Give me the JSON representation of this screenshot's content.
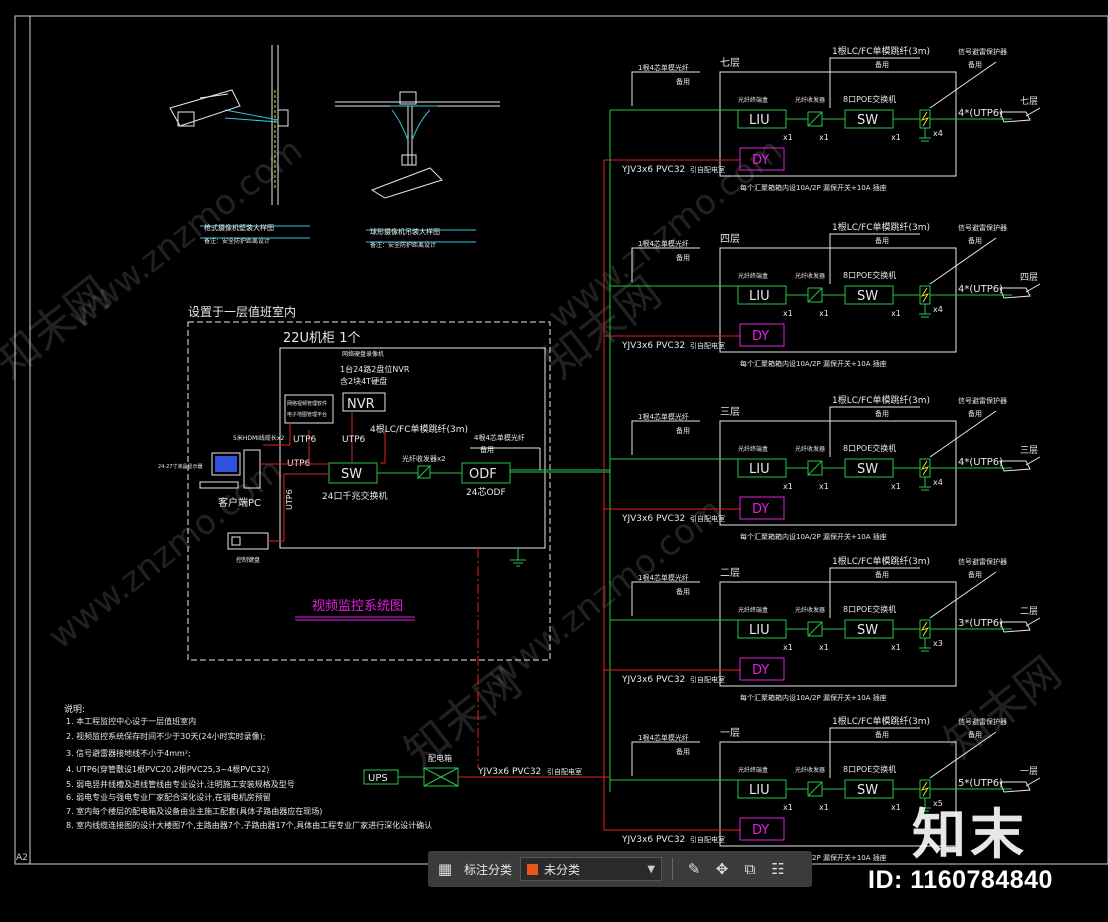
{
  "sheet": {
    "frame_label": "A2",
    "cabinet_room": "设置于一层值班室内",
    "cabinet": "22U机柜 1个",
    "nvr_header": "网络硬盘录像机",
    "nvr_desc1": "1台24路2盘位NVR",
    "nvr_desc2": "含2块4T硬盘",
    "nvr": "NVR",
    "mgmt_box1": "网络视频管理软件",
    "mgmt_box2": "电子地图管理平台",
    "hdmi": "5米HDMI线缆长x2",
    "utp6_a": "UTP6",
    "utp6_b": "UTP6",
    "utp6_c": "UTP6",
    "utp6_d": "UTP6",
    "sw": "SW",
    "sw_desc": "24口千兆交换机",
    "fiber_jumper": "4根LC/FC单模跳纤(3m)",
    "converter": "光纤收发器x2",
    "odf": "ODF",
    "odf_desc": "24芯ODF",
    "riser_fiber": "4根4芯单模光纤",
    "riser_fiber2": "备用",
    "client_pc": "客户端PC",
    "monitor_note": "24-27寸液晶显示器",
    "keyboard": "控制键盘",
    "title": "视频监控系统图",
    "detail1": "枪式摄像机壁装大样图",
    "detail1_note": "备注：安全防护距离设计",
    "detail2": "球形摄像机吊装大样图",
    "detail2_note": "备注：安全防护距离设计",
    "notes_title": "说明:",
    "notes": [
      "1. 本工程监控中心设于一层值班室内",
      "2. 视频监控系统保存时间不少于30天(24小时实时录像);",
      "3. 信号避雷器接地线不小于4mm²;",
      "4. UTP6(穿管敷设1根PVC20,2根PVC25,3~4根PVC32)",
      "5. 弱电竖井线槽及进线管线由专业设计,注明施工安装规格及型号",
      "6. 弱电专业与强电专业厂家配合深化设计,在弱电机房预留",
      "7. 室内每个楼层的配电箱及设备由业主施工配套(具体子路由器应在现场)",
      "8. 室内线缆连接图的设计大楼图7个,主路由器7个,子路由器17个,具体由工程专业厂家进行深化设计确认"
    ],
    "ups": "UPS",
    "pdu": "配电箱",
    "main_power": "YJV3x6 PVC32",
    "main_power_note": "引自配电室",
    "floors": [
      {
        "name": "七层",
        "tag": "七层",
        "cams": "4*(UTP6)",
        "x": "x4"
      },
      {
        "name": "四层",
        "tag": "四层",
        "cams": "4*(UTP6)",
        "x": "x4"
      },
      {
        "name": "三层",
        "tag": "三层",
        "cams": "4*(UTP6)",
        "x": "x4"
      },
      {
        "name": "二层",
        "tag": "二层",
        "cams": "3*(UTP6)",
        "x": "x3"
      },
      {
        "name": "一层",
        "tag": "一层",
        "cams": "5*(UTP6)",
        "x": "x5"
      }
    ],
    "floor_common": {
      "fiber": "1根4芯单模光纤",
      "spare": "备用",
      "jumper": "1根LC/FC单模跳纤(3m)",
      "jumper_spare": "备用",
      "surge": "信号避雷保护器",
      "surge_spare": "备用",
      "liu_label": "光纤终端盒",
      "liu": "LIU",
      "conv_label": "光纤收发器",
      "poe_label": "8口POE交换机",
      "sw": "SW",
      "x1": "x1",
      "dy": "DY",
      "power": "YJV3x6 PVC32",
      "power_note": "引自配电室",
      "breaker": "每个汇聚箱箱内设10A/2P 漏保开关+10A 插座"
    }
  },
  "toolbar": {
    "label": "标注分类",
    "select_value": "未分类",
    "icons": [
      "grid-icon",
      "edit-icon",
      "move-icon",
      "copy-icon",
      "paste-icon"
    ]
  },
  "watermark": {
    "site": "www.znzmo.com",
    "brand": "知末网",
    "logo": "知末",
    "id": "ID: 1160784840"
  },
  "colors": {
    "green": "#22c84a",
    "white": "#e8e8e8",
    "red": "#e02020",
    "magenta": "#e020e0",
    "cyan": "#30c8e0",
    "yellow": "#e0e020"
  }
}
